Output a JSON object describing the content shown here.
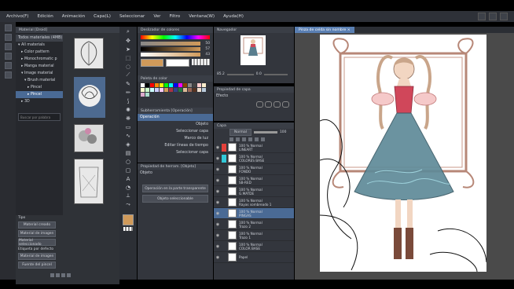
{
  "menubar": {
    "items": [
      "Archivo(F)",
      "Edición",
      "Animación",
      "Capa(L)",
      "Seleccionar",
      "Ver",
      "Filtro",
      "Ventana(W)",
      "Ayuda(H)"
    ]
  },
  "material_panel": {
    "tab_label": "Material [Droid]",
    "folder_title": "Todos materiales (4MB)",
    "tree": [
      {
        "label": "All materials",
        "selected": false
      },
      {
        "label": "Color pattern",
        "selected": false
      },
      {
        "label": "Monochromatic p",
        "selected": false
      },
      {
        "label": "Manga material",
        "selected": false
      },
      {
        "label": "Image material",
        "selected": false
      },
      {
        "label": "Brush material",
        "selected": false
      },
      {
        "label": "Pincel",
        "selected": false
      },
      {
        "label": "Pincel",
        "selected": true
      },
      {
        "label": "3D",
        "selected": false
      }
    ],
    "search_placeholder": "Buscar por palabra",
    "sub_panel_items": [
      "Tipo",
      "Material creado",
      "Material de imagen",
      "Material seleccionado",
      "Etiqueta por defecto",
      "Material de imagen",
      "Fuente del pincel"
    ]
  },
  "color_panel": {
    "title": "Deslizador de colores",
    "values": [
      "50",
      "57",
      "43"
    ],
    "palette_title": "Paleta de color"
  },
  "subview_panel": {
    "title": "Subherramienta [Operación]",
    "operation_label": "Operación",
    "items": [
      "Objeto",
      "Seleccionar capa",
      "Marco de luz",
      "Editar líneas de tiempo",
      "Seleccionar capa"
    ]
  },
  "tool_property": {
    "title": "Propiedad de herram. [Objeto]",
    "object_label": "Objeto",
    "btn1": "Operación en la parte transparente",
    "btn2": "Objeto seleccionable"
  },
  "navigator": {
    "title": "Navegador",
    "zoom": "85.2",
    "angle": "0.0"
  },
  "layer_property": {
    "title": "Propiedad de capa",
    "effect_label": "Efecto"
  },
  "layers": {
    "title": "Capa",
    "blend_mode": "Normal",
    "opacity": "100",
    "rows": [
      {
        "name": "100 % Normal",
        "sub": "LINEART",
        "selected": false,
        "color": "#e3403a"
      },
      {
        "name": "100 % Normal",
        "sub": "COLORES BASE",
        "selected": false,
        "color": "#32c8d8"
      },
      {
        "name": "100 % Normal",
        "sub": "FONDO",
        "selected": false,
        "color": ""
      },
      {
        "name": "100 % Normal",
        "sub": "SB-RED",
        "selected": false,
        "color": ""
      },
      {
        "name": "100 % Normal",
        "sub": "G.MATDE",
        "selected": false,
        "color": ""
      },
      {
        "name": "100 % Normal",
        "sub": "Rayas sombreado 1",
        "selected": false,
        "color": ""
      },
      {
        "name": "100 % Normal",
        "sub": "PINGAS",
        "selected": true,
        "color": ""
      },
      {
        "name": "100 % Normal",
        "sub": "Trazo 2",
        "selected": false,
        "color": ""
      },
      {
        "name": "100 % Normal",
        "sub": "Trazo 1",
        "selected": false,
        "color": ""
      },
      {
        "name": "100 % Normal",
        "sub": "COLOR BASE",
        "selected": false,
        "color": ""
      },
      {
        "name": "",
        "sub": "Papel",
        "selected": false,
        "color": ""
      }
    ]
  },
  "canvas": {
    "tab_label": "Pinza de celda sin nombre",
    "status": "",
    "accent": "#5a7fb2"
  }
}
